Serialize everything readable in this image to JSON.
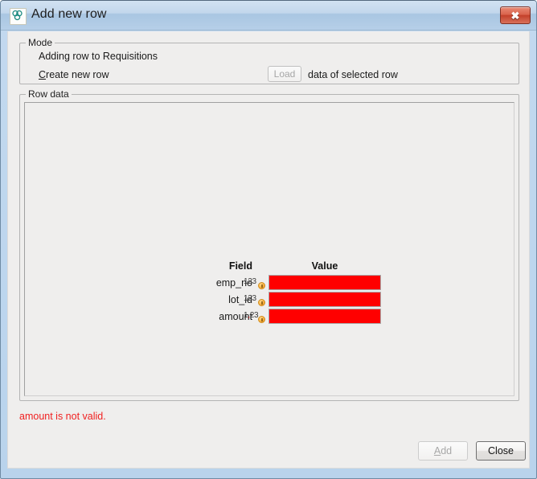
{
  "window": {
    "title": "Add new row",
    "app_icon": "molecule-icon",
    "close_button_label": "✖"
  },
  "mode": {
    "legend": "Mode",
    "status_text": "Adding row to Requisitions",
    "create_label_mnemonic": "C",
    "create_label_rest": "reate new row",
    "load_button": "Load",
    "load_caption": "data of selected row"
  },
  "row_data": {
    "legend": "Row data",
    "headers": {
      "field": "Field",
      "value": "Value"
    },
    "rows": [
      {
        "field": "emp_no",
        "type_icon": "integer-type-icon",
        "type_glyph": "123",
        "type_decimal": false,
        "value": "",
        "invalid": true,
        "color": "#ff0000"
      },
      {
        "field": "lot_id",
        "type_icon": "integer-type-icon",
        "type_glyph": "123",
        "type_decimal": false,
        "value": "",
        "invalid": true,
        "color": "#ff0000"
      },
      {
        "field": "amount",
        "type_icon": "decimal-type-icon",
        "type_glyph": "1,23",
        "type_decimal": true,
        "value": "",
        "invalid": true,
        "color": "#ff0000"
      }
    ]
  },
  "validation": {
    "message": "amount is not valid.",
    "color": "#f02020"
  },
  "footer": {
    "add_label_mnemonic": "A",
    "add_label_rest": "dd",
    "add_enabled": false,
    "close_label": "Close",
    "close_enabled": true
  }
}
